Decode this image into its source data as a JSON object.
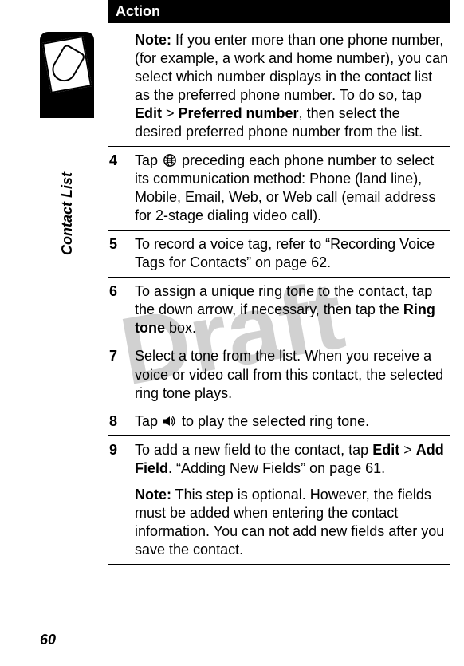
{
  "sidebar": {
    "label": "Contact List"
  },
  "page_number": "60",
  "watermark": "Draft",
  "action_header": "Action",
  "note_row": {
    "note_label": "Note:",
    "text_before": " If you enter more than one phone number, (for example, a work and home number), you can select which number displays in the contact list as the preferred phone number. To do so, tap ",
    "edit_label": "Edit",
    "gt": " > ",
    "pref_label": "Preferred number",
    "text_after": ", then select the desired preferred phone number from the list."
  },
  "step4": {
    "num": "4",
    "before_icon": "Tap ",
    "after_icon": " preceding each phone number to select its communication method: Phone (land line), Mobile, Email, Web, or Web call (email address for 2-stage dialing video call)."
  },
  "step5": {
    "num": "5",
    "text": "To record a voice tag, refer to “Recording Voice Tags for Contacts” on page 62."
  },
  "step6": {
    "num": "6",
    "before": "To assign a unique ring tone to the contact, tap the down arrow, if necessary, then tap the ",
    "ringtone": "Ring tone",
    "after": " box."
  },
  "step7": {
    "num": "7",
    "text": "Select a tone from the list. When you receive a voice or video call from this contact, the selected ring tone plays."
  },
  "step8": {
    "num": "8",
    "before_icon": "Tap ",
    "after_icon": " to play the selected ring tone."
  },
  "step9": {
    "num": "9",
    "before": "To add a new field to the contact, tap ",
    "edit_label": "Edit",
    "gt": " > ",
    "add_field": "Add Field",
    "after": ". “Adding New Fields” on page 61.",
    "note_label": "Note:",
    "note_text": " This step is optional. However, the fields must be added when entering the contact information. You can not add new fields after you save the contact."
  }
}
